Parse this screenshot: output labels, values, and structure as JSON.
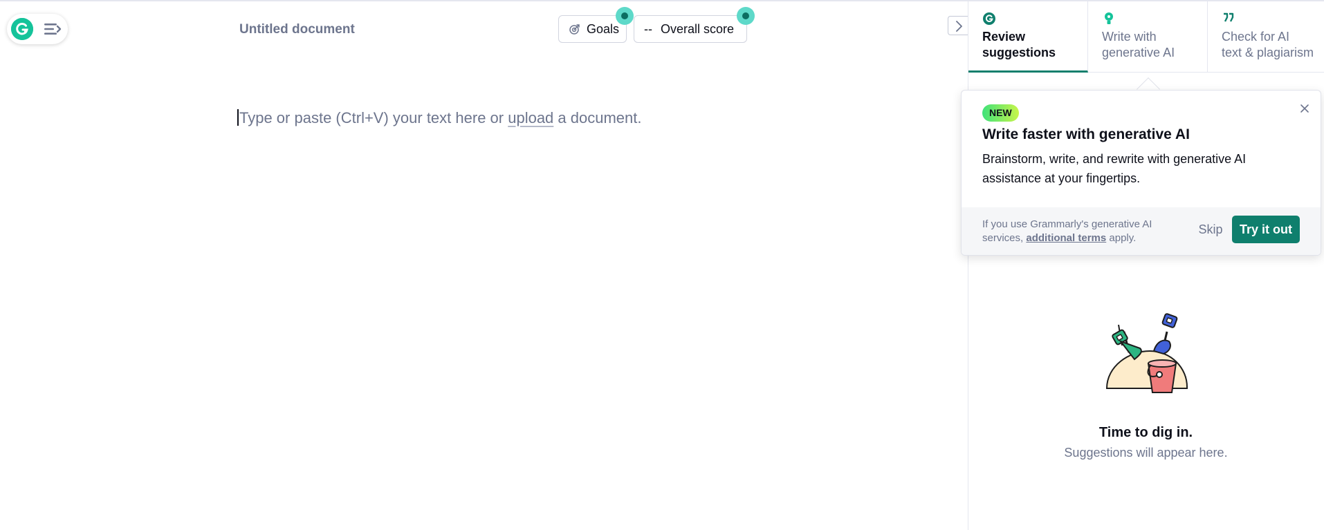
{
  "app": {
    "doc_title": "Untitled document"
  },
  "toolbar": {
    "goals_label": "Goals",
    "score_dashes": "--",
    "score_label": "Overall score"
  },
  "editor": {
    "placeholder_before": "Type or paste (Ctrl+V) your text here or ",
    "upload_link": "upload",
    "placeholder_after": " a document."
  },
  "sidebar": {
    "tabs": [
      {
        "line1": "Review",
        "line2": "suggestions",
        "icon": "grammarly-g-icon",
        "active": true
      },
      {
        "line1": "Write with",
        "line2": "generative AI",
        "icon": "lightbulb-icon",
        "active": false
      },
      {
        "line1": "Check for AI",
        "line2": "text & plagiarism",
        "icon": "quote-icon",
        "active": false
      }
    ]
  },
  "popover": {
    "badge": "NEW",
    "title": "Write faster with generative AI",
    "body": "Brainstorm, write, and rewrite with generative AI assistance at your fingertips.",
    "terms_before": "If you use Grammarly's generative AI services, ",
    "terms_link": "additional terms",
    "terms_after": " apply.",
    "skip_label": "Skip",
    "try_label": "Try it out"
  },
  "empty_state": {
    "title": "Time to dig in.",
    "subtitle": "Suggestions will appear here."
  },
  "colors": {
    "accent": "#0f7f6d",
    "brand_green": "#15c39a",
    "dot_teal": "#5ed9c9"
  }
}
